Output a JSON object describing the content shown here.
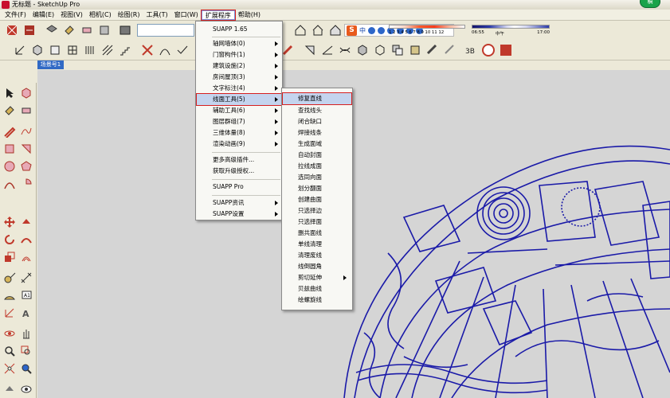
{
  "window": {
    "title": "无标题 - SketchUp Pro",
    "badge": "稿"
  },
  "menubar": [
    {
      "label": "文件(F)"
    },
    {
      "label": "编辑(E)"
    },
    {
      "label": "视图(V)"
    },
    {
      "label": "相机(C)"
    },
    {
      "label": "绘图(R)"
    },
    {
      "label": "工具(T)"
    },
    {
      "label": "窗口(W)"
    },
    {
      "label": "扩展程序"
    },
    {
      "label": "帮助(H)"
    }
  ],
  "ime": {
    "logo": "S",
    "mode": "中"
  },
  "shadow": {
    "months": "1 2 3 4 5 6 7 8 9 10 11 12",
    "time_start": "06:55",
    "time_mid": "中午",
    "time_end": "17:00"
  },
  "scene_tab": "场景号1",
  "extensions_menu": {
    "items": [
      {
        "label": "SUAPP 1.65",
        "submenu": false
      },
      {
        "label": "轴网墙体(0)",
        "submenu": true
      },
      {
        "label": "门窗构件(1)",
        "submenu": true
      },
      {
        "label": "建筑设施(2)",
        "submenu": true
      },
      {
        "label": "房间屋顶(3)",
        "submenu": true
      },
      {
        "label": "文字标注(4)",
        "submenu": true
      },
      {
        "label": "线面工具(5)",
        "submenu": true,
        "highlighted": true
      },
      {
        "label": "辅助工具(6)",
        "submenu": true
      },
      {
        "label": "图层群组(7)",
        "submenu": true
      },
      {
        "label": "三维体量(8)",
        "submenu": true
      },
      {
        "label": "渲染动画(9)",
        "submenu": true
      },
      {
        "label": "更多高级插件...",
        "submenu": false
      },
      {
        "label": "获取升级授权...",
        "submenu": false
      },
      {
        "label": "SUAPP Pro",
        "submenu": false
      },
      {
        "label": "SUAPP资讯",
        "submenu": true
      },
      {
        "label": "SUAPP设置",
        "submenu": true
      }
    ]
  },
  "line_tools_submenu": {
    "items": [
      {
        "label": "修复直线",
        "highlighted": true
      },
      {
        "label": "查找线头"
      },
      {
        "label": "闭合缺口"
      },
      {
        "label": "焊接线条"
      },
      {
        "label": "生成面域"
      },
      {
        "label": "自动封面"
      },
      {
        "label": "拉线成面"
      },
      {
        "label": "选同向面"
      },
      {
        "label": "划分翻面"
      },
      {
        "label": "创建曲面"
      },
      {
        "label": "只选择边"
      },
      {
        "label": "只选择面"
      },
      {
        "label": "删共面线"
      },
      {
        "label": "单线清理"
      },
      {
        "label": "清理废线"
      },
      {
        "label": "线倒圆角"
      },
      {
        "label": "剪切延伸",
        "submenu": true
      },
      {
        "label": "贝兹曲线"
      },
      {
        "label": "绘螺旋线"
      }
    ]
  },
  "colors": {
    "drawing": "#1a1aa8",
    "canvas": "#d5d5d5",
    "highlight_border": "#d62020"
  }
}
